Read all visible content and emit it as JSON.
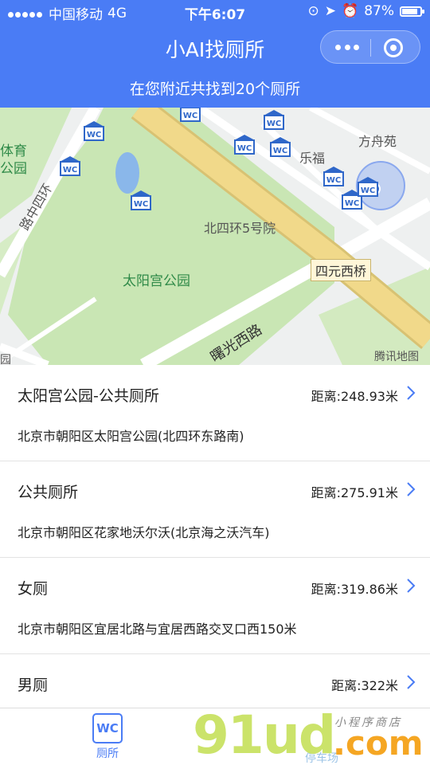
{
  "status_bar": {
    "carrier": "中国移动",
    "network": "4G",
    "time": "下午6:07",
    "battery": "87%",
    "battery_level": 0.87
  },
  "header": {
    "title": "小AI找厕所"
  },
  "subheader": {
    "text": "在您附近共找到20个厕所"
  },
  "map": {
    "labels": {
      "park": "太阳宫公园",
      "building": "北四环5号院",
      "bridge": "四元西桥",
      "area": "方舟苑",
      "store": "乐福",
      "road1": "曙光西路",
      "road2": "路中四环",
      "sports": "体育",
      "park_left": "公园",
      "bottom_left": "园",
      "attribution": "腾讯地图"
    },
    "pin_label": "WC",
    "colors": {
      "park_green": "#c9e6b4",
      "ring_road": "#f1d98a",
      "water": "#8ab7ea",
      "pin": "#2f67c9"
    }
  },
  "list": {
    "items": [
      {
        "name": "太阳宫公园-公共厕所",
        "distance": "距离:248.93米",
        "address": "北京市朝阳区太阳宫公园(北四环东路南)"
      },
      {
        "name": "公共厕所",
        "distance": "距离:275.91米",
        "address": "北京市朝阳区花家地沃尔沃(北京海之沃汽车)"
      },
      {
        "name": "女厕",
        "distance": "距离:319.86米",
        "address": "北京市朝阳区宜居北路与宜居西路交叉口西150米"
      },
      {
        "name": "男厕",
        "distance": "距离:322米",
        "address": ""
      }
    ]
  },
  "tabbar": {
    "tabs": [
      {
        "label": "厕所",
        "icon_text": "WC"
      },
      {
        "label": "停车场"
      }
    ]
  },
  "watermark": {
    "logo": "91ud",
    "suffix": ".com",
    "slogan": "小程序商店"
  }
}
